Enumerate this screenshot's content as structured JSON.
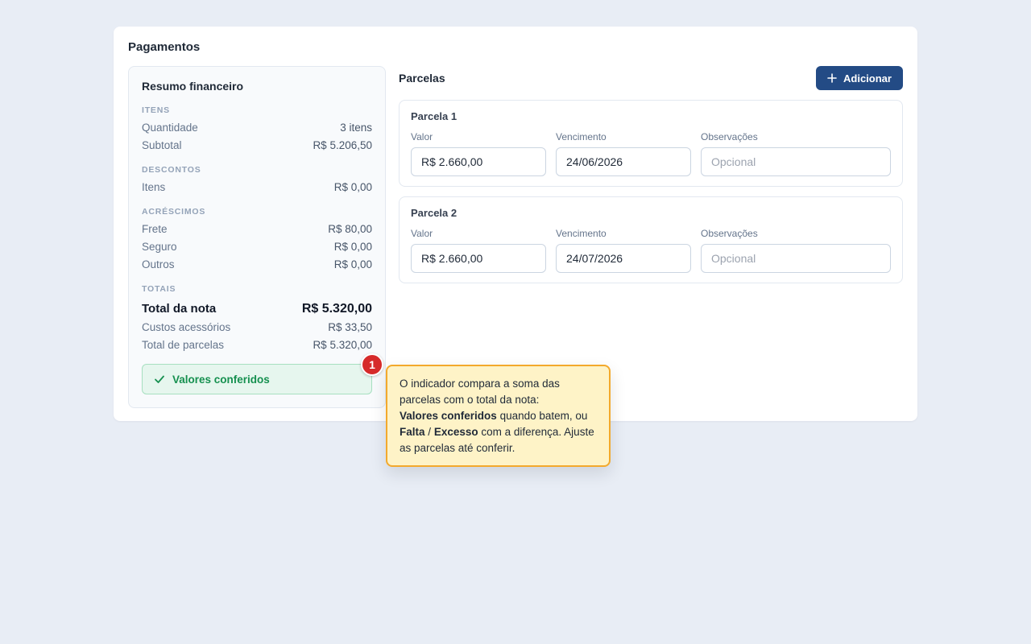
{
  "card": {
    "title": "Pagamentos"
  },
  "summary": {
    "title": "Resumo financeiro",
    "itens": {
      "label": "ITENS",
      "rows": [
        {
          "label": "Quantidade",
          "value": "3 itens"
        },
        {
          "label": "Subtotal",
          "value": "R$ 5.206,50"
        }
      ]
    },
    "descontos": {
      "label": "DESCONTOS",
      "rows": [
        {
          "label": "Itens",
          "value": "R$ 0,00"
        }
      ]
    },
    "acrescimos": {
      "label": "ACRÉSCIMOS",
      "rows": [
        {
          "label": "Frete",
          "value": "R$ 80,00"
        },
        {
          "label": "Seguro",
          "value": "R$ 0,00"
        },
        {
          "label": "Outros",
          "value": "R$ 0,00"
        }
      ]
    },
    "totais": {
      "label": "TOTAIS",
      "total_nota": {
        "label": "Total da nota",
        "value": "R$ 5.320,00"
      },
      "rows": [
        {
          "label": "Custos acessórios",
          "value": "R$ 33,50"
        },
        {
          "label": "Total de parcelas",
          "value": "R$ 5.320,00"
        }
      ]
    },
    "status": {
      "text": "Valores conferidos",
      "icon": "check-icon",
      "color": "#15904f"
    }
  },
  "parcelas": {
    "title": "Parcelas",
    "add_button": {
      "label": "Adicionar",
      "icon": "plus-icon",
      "color": "#234b85"
    },
    "items": [
      {
        "name": "Parcela 1",
        "valor_label": "Valor",
        "valor": "R$ 2.660,00",
        "vencimento_label": "Vencimento",
        "vencimento": "24/06/2026",
        "obs_label": "Observações",
        "obs_placeholder": "Opcional"
      },
      {
        "name": "Parcela 2",
        "valor_label": "Valor",
        "valor": "R$ 2.660,00",
        "vencimento_label": "Vencimento",
        "vencimento": "24/07/2026",
        "obs_label": "Observações",
        "obs_placeholder": "Opcional"
      }
    ]
  },
  "annotation": {
    "number": "1",
    "text_1": "O indicador compara a soma das parcelas com o total da nota:",
    "bold_1": "Valores conferidos",
    "text_2": "quando batem, ou",
    "bold_2": "Falta",
    "text_3": "/",
    "bold_3": "Excesso",
    "text_4": "com a diferença. Ajuste as parcelas até conferir."
  }
}
